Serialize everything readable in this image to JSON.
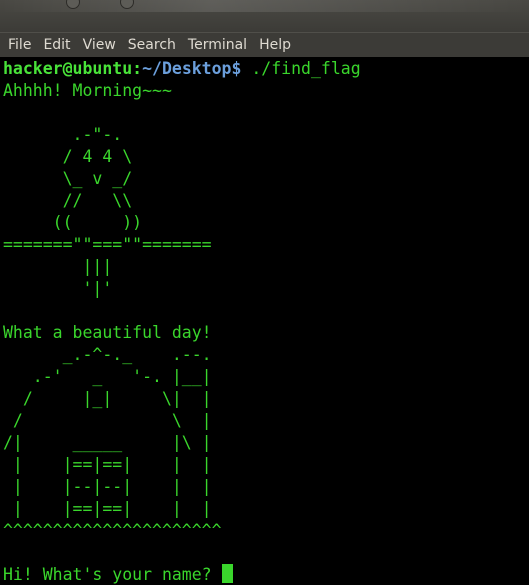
{
  "menu": {
    "file": "File",
    "edit": "Edit",
    "view": "View",
    "search": "Search",
    "terminal": "Terminal",
    "help": "Help"
  },
  "prompt": {
    "user_host": "hacker@ubuntu",
    "separator": ":",
    "path": "~/Desktop",
    "symbol": "$",
    "command": " ./find_flag"
  },
  "output": {
    "greeting": "Ahhhh! Morning~~~",
    "owl": [
      "       .-\"-.",
      "      / 4 4 \\",
      "      \\_ v _/",
      "      //   \\\\",
      "     ((     ))",
      "=======\"\"===\"\"=======",
      "        |||",
      "        '|'"
    ],
    "day_message": "What a beautiful day!",
    "house": [
      "      _.-^-._    .--.",
      "   .-'   _   '-. |__|",
      "  /     |_|     \\|  |",
      " /               \\  |",
      "/|     _____     |\\ |",
      " |    |==|==|    |  |",
      " |    |--|--|    |  |",
      " |    |==|==|    |  |",
      "^^^^^^^^^^^^^^^^^^^^^^"
    ],
    "name_question": "Hi! What's your name? "
  },
  "colors": {
    "terminal_text": "#3ad62c",
    "prompt_user": "#49e339",
    "prompt_path": "#6b9fdc",
    "menubar_bg": "#3c3b37",
    "terminal_bg": "#000000"
  }
}
